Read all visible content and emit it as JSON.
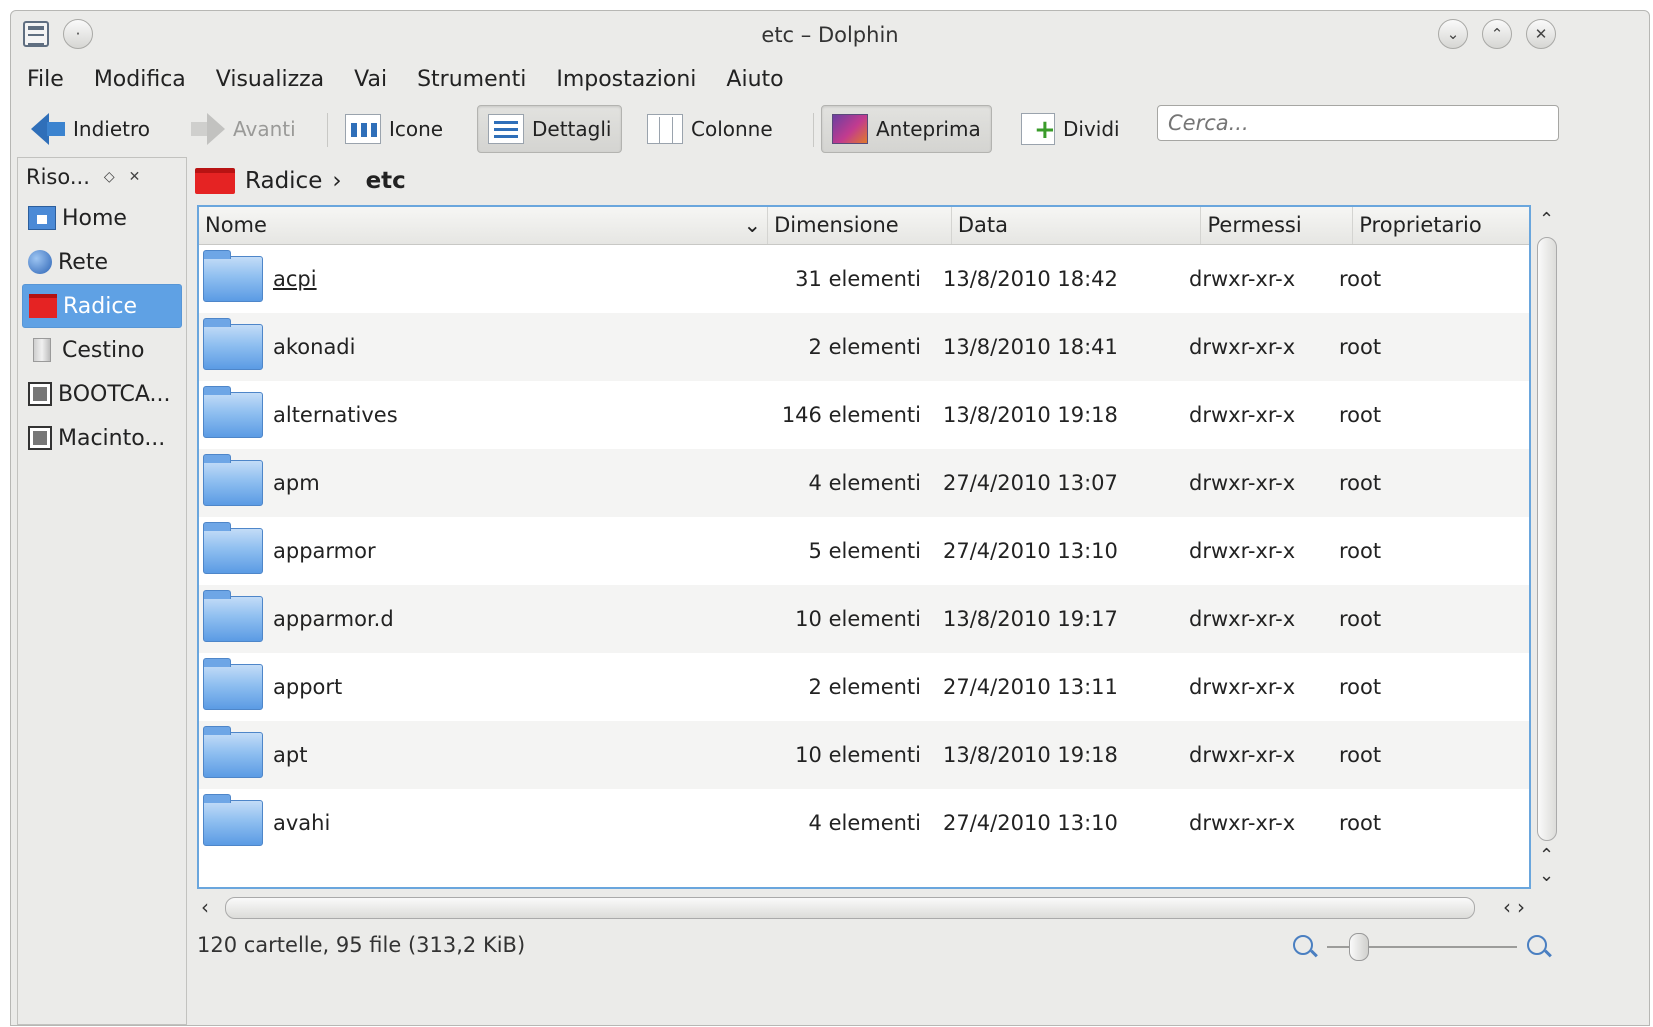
{
  "window": {
    "title": "etc – Dolphin"
  },
  "menu": [
    "File",
    "Modifica",
    "Visualizza",
    "Vai",
    "Strumenti",
    "Impostazioni",
    "Aiuto"
  ],
  "toolbar": {
    "back": "Indietro",
    "forward": "Avanti",
    "icons": "Icone",
    "details": "Dettagli",
    "columns": "Colonne",
    "preview": "Anteprima",
    "split": "Dividi"
  },
  "search": {
    "placeholder": "Cerca..."
  },
  "sidebar": {
    "title": "Riso...",
    "items": [
      {
        "label": "Home",
        "icon": "home-folder-icon"
      },
      {
        "label": "Rete",
        "icon": "network-globe-icon"
      },
      {
        "label": "Radice",
        "icon": "root-folder-icon"
      },
      {
        "label": "Cestino",
        "icon": "trash-icon"
      },
      {
        "label": "BOOTCA...",
        "icon": "drive-icon"
      },
      {
        "label": "Macinto...",
        "icon": "drive-icon"
      }
    ]
  },
  "breadcrumb": {
    "parent": "Radice",
    "current": "etc"
  },
  "columns": {
    "name": "Nome",
    "size": "Dimensione",
    "date": "Data",
    "perms": "Permessi",
    "owner": "Proprietario"
  },
  "files": [
    {
      "name": "acpi",
      "size": "31 elementi",
      "date": "13/8/2010 18:42",
      "perms": "drwxr-xr-x",
      "owner": "root"
    },
    {
      "name": "akonadi",
      "size": "2 elementi",
      "date": "13/8/2010 18:41",
      "perms": "drwxr-xr-x",
      "owner": "root"
    },
    {
      "name": "alternatives",
      "size": "146 elementi",
      "date": "13/8/2010 19:18",
      "perms": "drwxr-xr-x",
      "owner": "root"
    },
    {
      "name": "apm",
      "size": "4 elementi",
      "date": "27/4/2010 13:07",
      "perms": "drwxr-xr-x",
      "owner": "root"
    },
    {
      "name": "apparmor",
      "size": "5 elementi",
      "date": "27/4/2010 13:10",
      "perms": "drwxr-xr-x",
      "owner": "root"
    },
    {
      "name": "apparmor.d",
      "size": "10 elementi",
      "date": "13/8/2010 19:17",
      "perms": "drwxr-xr-x",
      "owner": "root"
    },
    {
      "name": "apport",
      "size": "2 elementi",
      "date": "27/4/2010 13:11",
      "perms": "drwxr-xr-x",
      "owner": "root"
    },
    {
      "name": "apt",
      "size": "10 elementi",
      "date": "13/8/2010 19:18",
      "perms": "drwxr-xr-x",
      "owner": "root"
    },
    {
      "name": "avahi",
      "size": "4 elementi",
      "date": "27/4/2010 13:10",
      "perms": "drwxr-xr-x",
      "owner": "root"
    }
  ],
  "status": {
    "text": "120 cartelle, 95 file (313,2 KiB)"
  }
}
